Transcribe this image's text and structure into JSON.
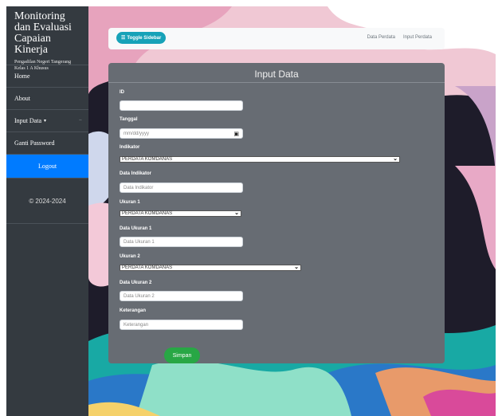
{
  "sidebar": {
    "title": "Monitoring dan Evaluasi Capaian Kinerja",
    "subtitle": "Pengadilan Negeri Tangerang Kelas 1 A Khusus",
    "items": [
      {
        "label": "Home"
      },
      {
        "label": "About"
      },
      {
        "label": "Input Data",
        "caret": "▾",
        "minus": "−"
      },
      {
        "label": "Ganti Password"
      },
      {
        "label": "Logout"
      }
    ],
    "copyright": "© 2024-2024"
  },
  "topbar": {
    "toggle_label": "Toggle Sidebar",
    "toggle_icon": "☰",
    "links": [
      "Data Perdata",
      "Input Perdata"
    ]
  },
  "form": {
    "title": "Input Data",
    "fields": {
      "id_label": "ID",
      "tanggal_label": "Tanggal",
      "tanggal_placeholder": "mm/dd/yyyy",
      "indikator_label": "Indikator",
      "indikator_value": "PERDATA KOMDANAS",
      "data_indikator_label": "Data Indikator",
      "data_indikator_placeholder": "Data Indikator",
      "ukuran1_label": "Ukuran 1",
      "ukuran1_value": "PERDATA KOMDANAS",
      "data_ukuran1_label": "Data Ukuran 1",
      "data_ukuran1_placeholder": "Data Ukuran 1",
      "ukuran2_label": "Ukuran 2",
      "ukuran2_value": "PERDATA KOMDANAS",
      "data_ukuran2_label": "Data Ukuran 2",
      "data_ukuran2_placeholder": "Data Ukuran 2",
      "keterangan_label": "Keterangan",
      "keterangan_placeholder": "Keterangan"
    },
    "submit_label": "Simpan"
  },
  "colors": {
    "sidebar_bg": "#343a40",
    "active": "#007bff",
    "toggle": "#17a2b8",
    "submit": "#28a745",
    "card": "#676c73"
  }
}
